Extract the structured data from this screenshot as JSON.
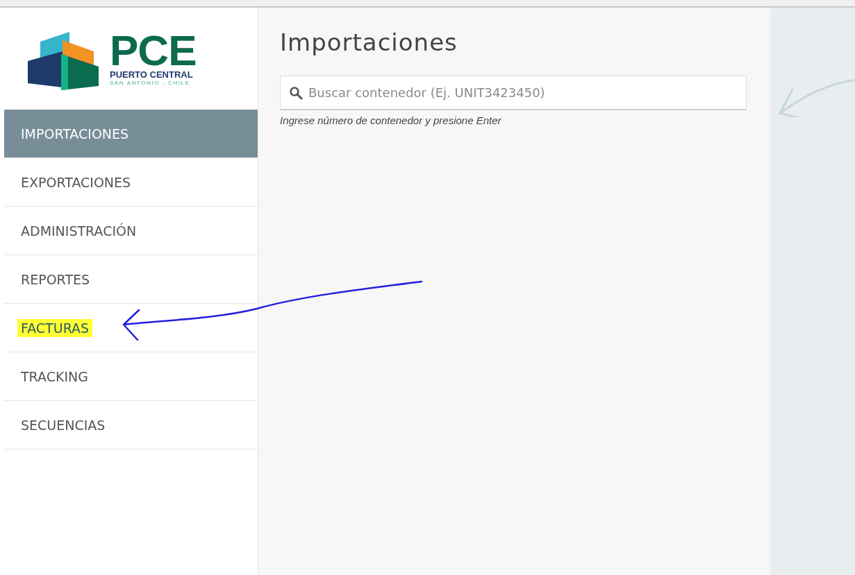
{
  "logo": {
    "name": "PCE",
    "line_1": "PUERTO CENTRAL",
    "line_2": "SAN ANTONIO - CHILE"
  },
  "sidebar": {
    "items": [
      {
        "label": "IMPORTACIONES",
        "selected": true,
        "highlighted": false
      },
      {
        "label": "EXPORTACIONES",
        "selected": false,
        "highlighted": false
      },
      {
        "label": "ADMINISTRACIÓN",
        "selected": false,
        "highlighted": false
      },
      {
        "label": "REPORTES",
        "selected": false,
        "highlighted": false
      },
      {
        "label": "FACTURAS",
        "selected": false,
        "highlighted": true
      },
      {
        "label": "TRACKING",
        "selected": false,
        "highlighted": false
      },
      {
        "label": "SECUENCIAS",
        "selected": false,
        "highlighted": false
      }
    ]
  },
  "main": {
    "title": "Importaciones",
    "search": {
      "placeholder": "Buscar contenedor (Ej. UNIT3423450)",
      "hint": "Ingrese número de contenedor y presione Enter"
    }
  }
}
